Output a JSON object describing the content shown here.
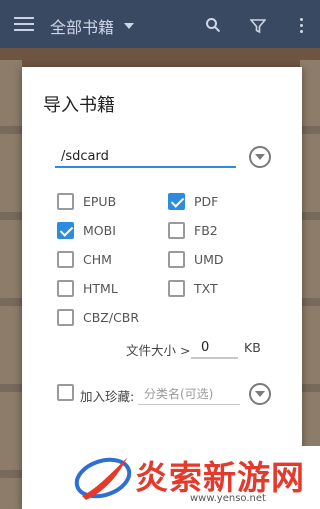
{
  "appbar": {
    "title": "全部书籍",
    "icons": [
      "menu-icon",
      "dropdown-icon",
      "search-icon",
      "filter-icon",
      "more-icon"
    ]
  },
  "dialog": {
    "title": "导入书籍",
    "path": {
      "value": "/sdcard"
    },
    "formats": [
      {
        "label": "EPUB",
        "checked": false
      },
      {
        "label": "PDF",
        "checked": true
      },
      {
        "label": "MOBI",
        "checked": true
      },
      {
        "label": "FB2",
        "checked": false
      },
      {
        "label": "CHM",
        "checked": false
      },
      {
        "label": "UMD",
        "checked": false
      },
      {
        "label": "HTML",
        "checked": false
      },
      {
        "label": "TXT",
        "checked": false
      },
      {
        "label": "CBZ/CBR",
        "checked": false
      }
    ],
    "size_filter": {
      "label": "文件大小 >",
      "value": "0",
      "unit": "KB"
    },
    "favorite": {
      "label": "加入珍藏:",
      "checked": false,
      "category_placeholder": "分类名(可选)"
    }
  },
  "colors": {
    "accent": "#2e8ce0",
    "appbar": "#1f4d86",
    "watermark": "#e33a2c"
  },
  "watermark": {
    "name": "炎索新游网",
    "url": "www.yenso.net"
  }
}
